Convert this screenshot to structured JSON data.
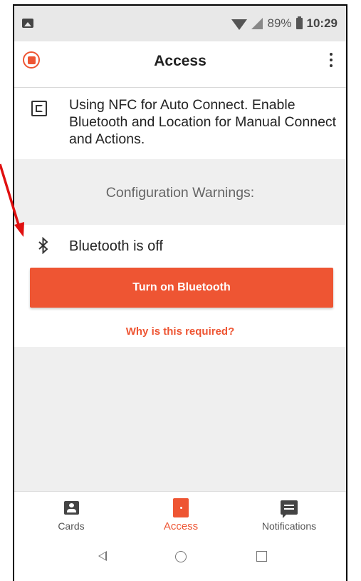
{
  "status_bar": {
    "battery": "89%",
    "time": "10:29"
  },
  "app_bar": {
    "title": "Access"
  },
  "nfc_notice": {
    "text": "Using NFC for Auto Connect. Enable Bluetooth and Location for Manual Connect and Actions."
  },
  "warnings": {
    "heading": "Configuration Warnings:"
  },
  "bluetooth": {
    "status_text": "Bluetooth is off",
    "turn_on_label": "Turn on Bluetooth",
    "why_link": "Why is this required?"
  },
  "bottom_nav": {
    "items": [
      {
        "label": "Cards",
        "icon": "cards-icon",
        "active": false
      },
      {
        "label": "Access",
        "icon": "access-icon",
        "active": true
      },
      {
        "label": "Notifications",
        "icon": "notifications-icon",
        "active": false
      }
    ]
  },
  "colors": {
    "accent": "#ee5533",
    "annotation_arrow": "#e01010"
  }
}
